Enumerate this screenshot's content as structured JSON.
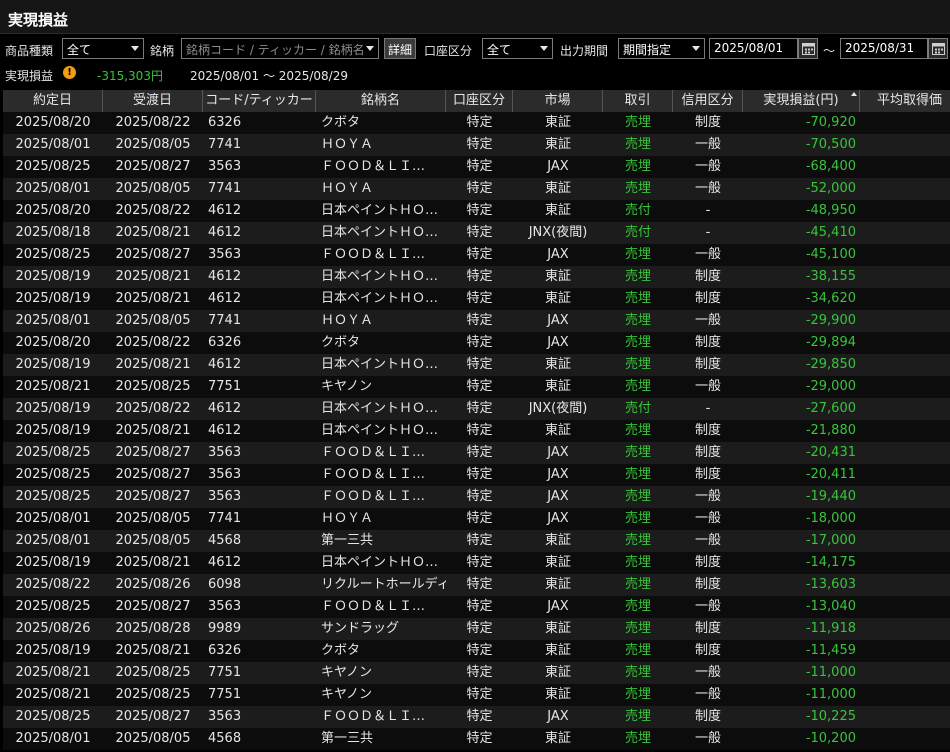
{
  "window": {
    "title": "実現損益"
  },
  "filters": {
    "product_label": "商品種類",
    "product_value": "全て",
    "symbol_label": "銘柄",
    "symbol_placeholder": "銘柄コード / ティッカー / 銘柄名",
    "detail_button": "詳細",
    "account_label": "口座区分",
    "account_value": "全て",
    "period_label": "出力期間",
    "period_value": "期間指定",
    "date_from": "2025/08/01",
    "tilde": "～",
    "date_to": "2025/08/31"
  },
  "summary": {
    "label": "実現損益",
    "warning_mark": "!",
    "value": "-315,303円",
    "range": "2025/08/01 ～ 2025/08/29"
  },
  "colors": {
    "profit_negative": "#38c43b",
    "trade_text": "#38c43b"
  },
  "table": {
    "headers": [
      "約定日",
      "受渡日",
      "コード/ティッカー",
      "銘柄名",
      "口座区分",
      "市場",
      "取引",
      "信用区分",
      "実現損益(円)",
      "平均取得価"
    ],
    "rows": [
      [
        "2025/08/20",
        "2025/08/22",
        "6326",
        "クボタ",
        "特定",
        "東証",
        "売埋",
        "制度",
        "-70,920"
      ],
      [
        "2025/08/01",
        "2025/08/05",
        "7741",
        "ＨＯＹＡ",
        "特定",
        "東証",
        "売埋",
        "一般",
        "-70,500"
      ],
      [
        "2025/08/25",
        "2025/08/27",
        "3563",
        "ＦＯＯＤ＆ＬＩ…",
        "特定",
        "JAX",
        "売埋",
        "一般",
        "-68,400"
      ],
      [
        "2025/08/01",
        "2025/08/05",
        "7741",
        "ＨＯＹＡ",
        "特定",
        "東証",
        "売埋",
        "一般",
        "-52,000"
      ],
      [
        "2025/08/20",
        "2025/08/22",
        "4612",
        "日本ペイントＨＯ…",
        "特定",
        "東証",
        "売付",
        "-",
        "-48,950"
      ],
      [
        "2025/08/18",
        "2025/08/21",
        "4612",
        "日本ペイントＨＯ…",
        "特定",
        "JNX(夜間)",
        "売付",
        "-",
        "-45,410"
      ],
      [
        "2025/08/25",
        "2025/08/27",
        "3563",
        "ＦＯＯＤ＆ＬＩ…",
        "特定",
        "JAX",
        "売埋",
        "一般",
        "-45,100"
      ],
      [
        "2025/08/19",
        "2025/08/21",
        "4612",
        "日本ペイントＨＯ…",
        "特定",
        "東証",
        "売埋",
        "制度",
        "-38,155"
      ],
      [
        "2025/08/19",
        "2025/08/21",
        "4612",
        "日本ペイントＨＯ…",
        "特定",
        "東証",
        "売埋",
        "制度",
        "-34,620"
      ],
      [
        "2025/08/01",
        "2025/08/05",
        "7741",
        "ＨＯＹＡ",
        "特定",
        "JAX",
        "売埋",
        "一般",
        "-29,900"
      ],
      [
        "2025/08/20",
        "2025/08/22",
        "6326",
        "クボタ",
        "特定",
        "JAX",
        "売埋",
        "制度",
        "-29,894"
      ],
      [
        "2025/08/19",
        "2025/08/21",
        "4612",
        "日本ペイントＨＯ…",
        "特定",
        "東証",
        "売埋",
        "制度",
        "-29,850"
      ],
      [
        "2025/08/21",
        "2025/08/25",
        "7751",
        "キヤノン",
        "特定",
        "東証",
        "売埋",
        "一般",
        "-29,000"
      ],
      [
        "2025/08/19",
        "2025/08/22",
        "4612",
        "日本ペイントＨＯ…",
        "特定",
        "JNX(夜間)",
        "売付",
        "-",
        "-27,600"
      ],
      [
        "2025/08/19",
        "2025/08/21",
        "4612",
        "日本ペイントＨＯ…",
        "特定",
        "東証",
        "売埋",
        "制度",
        "-21,880"
      ],
      [
        "2025/08/25",
        "2025/08/27",
        "3563",
        "ＦＯＯＤ＆ＬＩ…",
        "特定",
        "JAX",
        "売埋",
        "制度",
        "-20,431"
      ],
      [
        "2025/08/25",
        "2025/08/27",
        "3563",
        "ＦＯＯＤ＆ＬＩ…",
        "特定",
        "JAX",
        "売埋",
        "制度",
        "-20,411"
      ],
      [
        "2025/08/25",
        "2025/08/27",
        "3563",
        "ＦＯＯＤ＆ＬＩ…",
        "特定",
        "JAX",
        "売埋",
        "一般",
        "-19,440"
      ],
      [
        "2025/08/01",
        "2025/08/05",
        "7741",
        "ＨＯＹＡ",
        "特定",
        "JAX",
        "売埋",
        "一般",
        "-18,000"
      ],
      [
        "2025/08/01",
        "2025/08/05",
        "4568",
        "第一三共",
        "特定",
        "東証",
        "売埋",
        "一般",
        "-17,000"
      ],
      [
        "2025/08/19",
        "2025/08/21",
        "4612",
        "日本ペイントＨＯ…",
        "特定",
        "東証",
        "売埋",
        "制度",
        "-14,175"
      ],
      [
        "2025/08/22",
        "2025/08/26",
        "6098",
        "リクルートホールディ…",
        "特定",
        "東証",
        "売埋",
        "制度",
        "-13,603"
      ],
      [
        "2025/08/25",
        "2025/08/27",
        "3563",
        "ＦＯＯＤ＆ＬＩ…",
        "特定",
        "JAX",
        "売埋",
        "一般",
        "-13,040"
      ],
      [
        "2025/08/26",
        "2025/08/28",
        "9989",
        "サンドラッグ",
        "特定",
        "東証",
        "売埋",
        "制度",
        "-11,918"
      ],
      [
        "2025/08/19",
        "2025/08/21",
        "6326",
        "クボタ",
        "特定",
        "東証",
        "売埋",
        "制度",
        "-11,459"
      ],
      [
        "2025/08/21",
        "2025/08/25",
        "7751",
        "キヤノン",
        "特定",
        "東証",
        "売埋",
        "一般",
        "-11,000"
      ],
      [
        "2025/08/21",
        "2025/08/25",
        "7751",
        "キヤノン",
        "特定",
        "東証",
        "売埋",
        "一般",
        "-11,000"
      ],
      [
        "2025/08/25",
        "2025/08/27",
        "3563",
        "ＦＯＯＤ＆ＬＩ…",
        "特定",
        "JAX",
        "売埋",
        "制度",
        "-10,225"
      ],
      [
        "2025/08/01",
        "2025/08/05",
        "4568",
        "第一三共",
        "特定",
        "東証",
        "売埋",
        "一般",
        "-10,200"
      ]
    ]
  }
}
